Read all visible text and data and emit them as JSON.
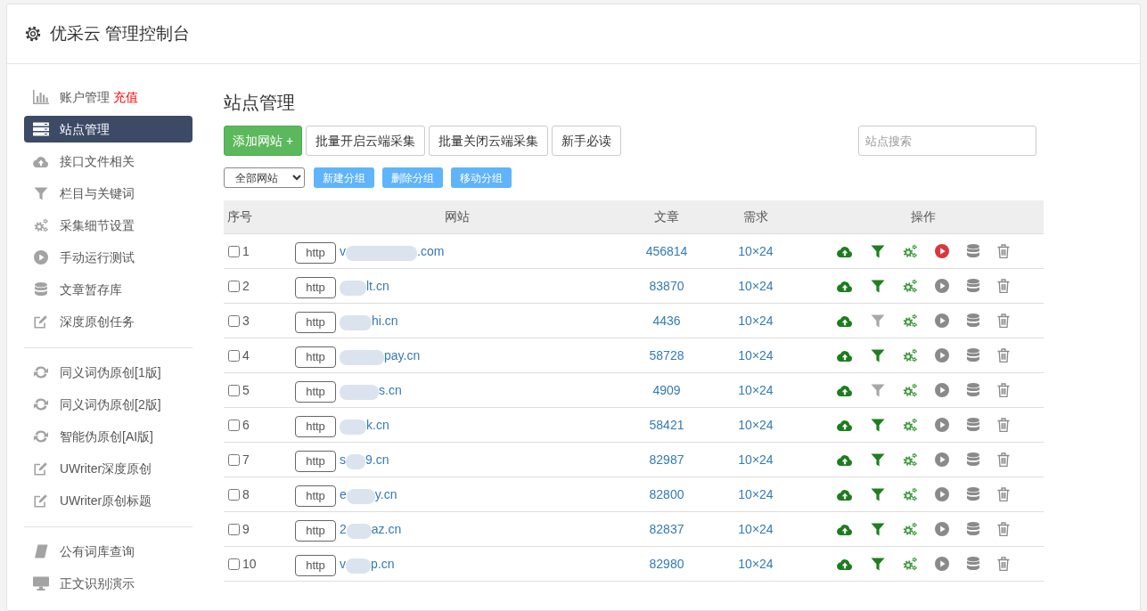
{
  "header": {
    "title": "优采云 管理控制台"
  },
  "sidebar": {
    "groups": [
      {
        "items": [
          {
            "label": "账户管理",
            "badge": "充值",
            "selected": false
          },
          {
            "label": "站点管理",
            "selected": true
          },
          {
            "label": "接口文件相关",
            "selected": false
          },
          {
            "label": "栏目与关键词",
            "selected": false
          },
          {
            "label": "采集细节设置",
            "selected": false
          },
          {
            "label": "手动运行测试",
            "selected": false
          },
          {
            "label": "文章暂存库",
            "selected": false
          },
          {
            "label": "深度原创任务",
            "selected": false
          }
        ]
      },
      {
        "items": [
          {
            "label": "同义词伪原创[1版]",
            "selected": false
          },
          {
            "label": "同义词伪原创[2版]",
            "selected": false
          },
          {
            "label": "智能伪原创[AI版]",
            "selected": false
          },
          {
            "label": "UWriter深度原创",
            "selected": false
          },
          {
            "label": "UWriter原创标题",
            "selected": false
          }
        ]
      },
      {
        "items": [
          {
            "label": "公有词库查询",
            "selected": false
          },
          {
            "label": "正文识别演示",
            "selected": false
          }
        ]
      }
    ]
  },
  "main": {
    "title": "站点管理",
    "toolbar": {
      "buttons": [
        {
          "label": "添加网站 +",
          "kind": "primary"
        },
        {
          "label": "批量开启云端采集",
          "kind": "default"
        },
        {
          "label": "批量关闭云端采集",
          "kind": "default"
        },
        {
          "label": "新手必读",
          "kind": "default"
        }
      ],
      "search": {
        "placeholder": "站点搜索"
      }
    },
    "group_bar": {
      "select": "全部网站",
      "buttons": [
        "新建分组",
        "删除分组",
        "移动分组"
      ]
    },
    "table": {
      "columns": [
        "序号",
        "网站",
        "文章",
        "需求",
        "操作"
      ],
      "rows": [
        {
          "checked": false,
          "index": "1",
          "scheme": "http",
          "site_prefix": "v",
          "site_suffix": ".com",
          "articles": "456814",
          "demand": "10×24",
          "filter_on": true,
          "running": true
        },
        {
          "checked": false,
          "index": "2",
          "scheme": "http",
          "site_suffix": "lt.cn",
          "articles": "83870",
          "demand": "10×24",
          "filter_on": true,
          "running": false
        },
        {
          "checked": false,
          "index": "3",
          "scheme": "http",
          "site_suffix": "hi.cn",
          "articles": "4436",
          "demand": "10×24",
          "filter_on": false,
          "running": false
        },
        {
          "checked": false,
          "index": "4",
          "scheme": "http",
          "site_suffix": "pay.cn",
          "articles": "58728",
          "demand": "10×24",
          "filter_on": true,
          "running": false
        },
        {
          "checked": false,
          "index": "5",
          "scheme": "http",
          "site_suffix": "s.cn",
          "articles": "4909",
          "demand": "10×24",
          "filter_on": false,
          "running": false
        },
        {
          "checked": false,
          "index": "6",
          "scheme": "http",
          "site_suffix": "k.cn",
          "articles": "58421",
          "demand": "10×24",
          "filter_on": true,
          "running": false
        },
        {
          "checked": false,
          "index": "7",
          "scheme": "http",
          "site_prefix": "s",
          "site_suffix": "9.cn",
          "articles": "82987",
          "demand": "10×24",
          "filter_on": true,
          "running": false
        },
        {
          "checked": false,
          "index": "8",
          "scheme": "http",
          "site_prefix": "e",
          "site_suffix": "y.cn",
          "articles": "82800",
          "demand": "10×24",
          "filter_on": true,
          "running": false
        },
        {
          "checked": false,
          "index": "9",
          "scheme": "http",
          "site_prefix": "2",
          "site_suffix": "az.cn",
          "articles": "82837",
          "demand": "10×24",
          "filter_on": true,
          "running": false
        },
        {
          "checked": false,
          "index": "10",
          "scheme": "http",
          "site_prefix": "v",
          "site_suffix": "p.cn",
          "articles": "82980",
          "demand": "10×24",
          "filter_on": true,
          "running": false
        }
      ]
    }
  }
}
